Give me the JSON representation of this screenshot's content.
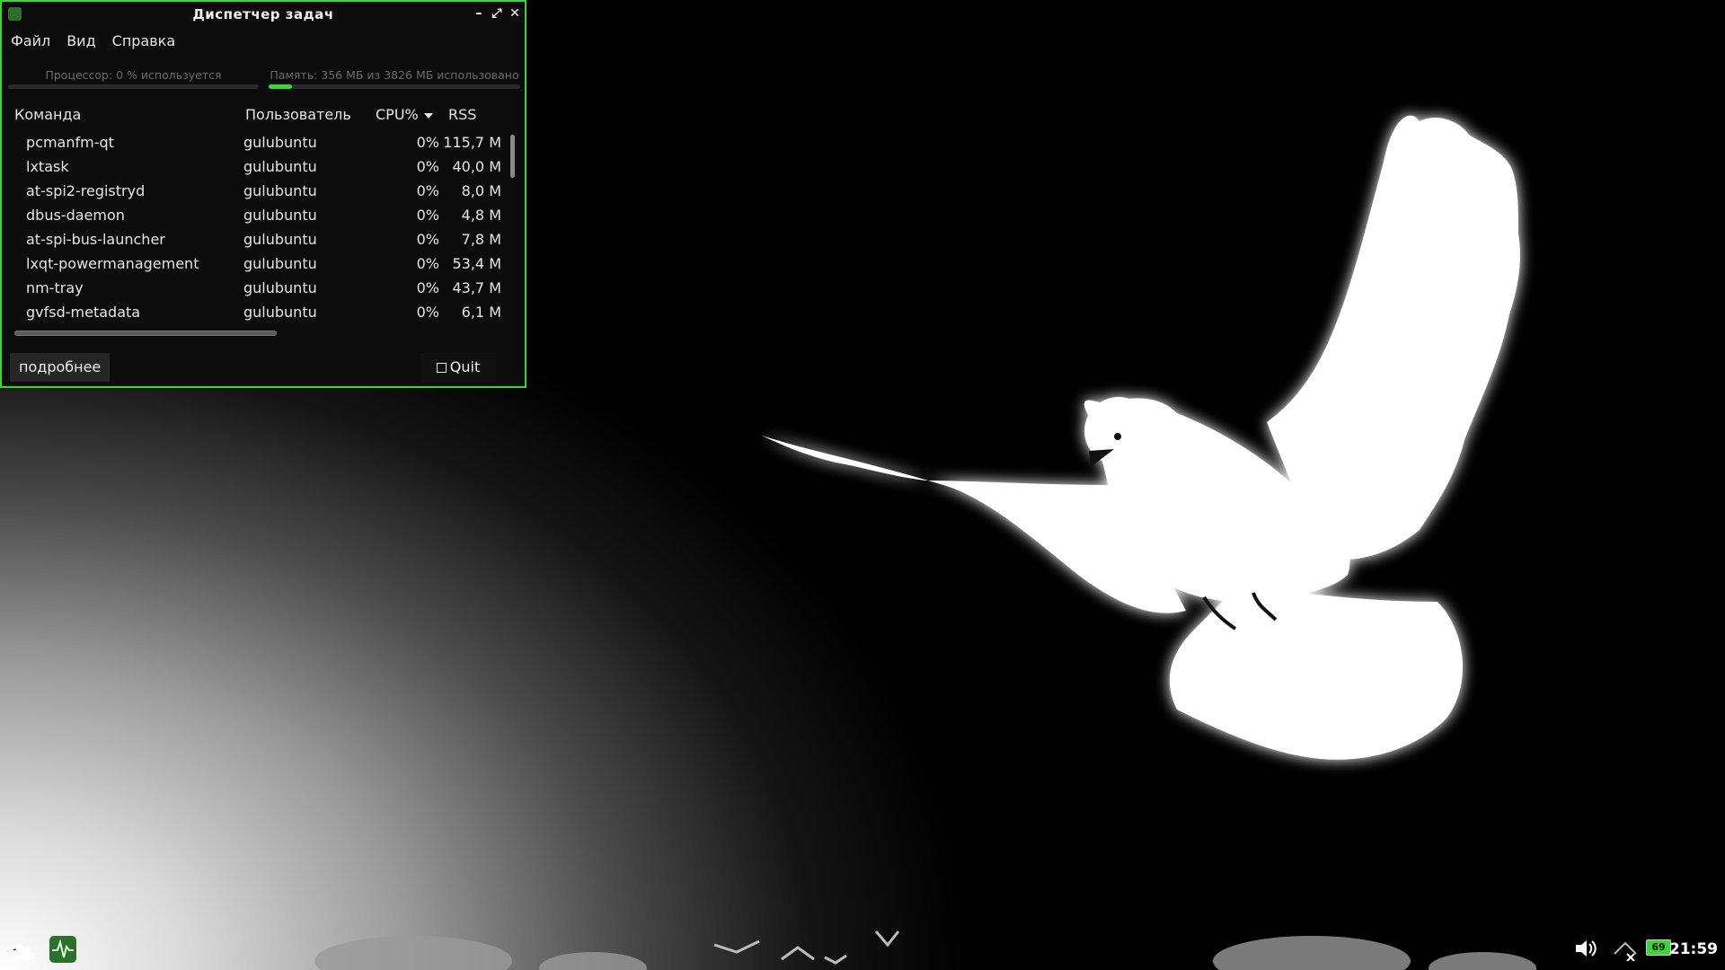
{
  "window": {
    "title": "Диспетчер задач",
    "minimize": "–",
    "maximize": "⤢",
    "close": "✕"
  },
  "menu": [
    "Файл",
    "Вид",
    "Справка"
  ],
  "meters": {
    "cpu_label": "Процессор: 0 % используется",
    "cpu_fraction": 0.0,
    "mem_label": "Память: 356 МБ из 3826 МБ использовано",
    "mem_fraction": 0.093
  },
  "columns": {
    "command": "Команда",
    "user": "Пользователь",
    "cpu": "CPU%",
    "rss": "RSS"
  },
  "processes": [
    {
      "command": "pcmanfm-qt",
      "user": "gulubuntu",
      "cpu": "0%",
      "rss": "115,7 M"
    },
    {
      "command": "lxtask",
      "user": "gulubuntu",
      "cpu": "0%",
      "rss": "40,0 M"
    },
    {
      "command": "at-spi2-registryd",
      "user": "gulubuntu",
      "cpu": "0%",
      "rss": "8,0 M"
    },
    {
      "command": "dbus-daemon",
      "user": "gulubuntu",
      "cpu": "0%",
      "rss": "4,8 M"
    },
    {
      "command": "at-spi-bus-launcher",
      "user": "gulubuntu",
      "cpu": "0%",
      "rss": "7,8 M"
    },
    {
      "command": "lxqt-powermanagement",
      "user": "gulubuntu",
      "cpu": "0%",
      "rss": "53,4 M"
    },
    {
      "command": "nm-tray",
      "user": "gulubuntu",
      "cpu": "0%",
      "rss": "43,7 M"
    },
    {
      "command": "gvfsd-metadata",
      "user": "gulubuntu",
      "cpu": "0%",
      "rss": "6,1 M"
    }
  ],
  "buttons": {
    "details": "подробнее",
    "quit": "Quit"
  },
  "taskbar": {
    "battery_level": "69",
    "clock": "21:59"
  },
  "colors": {
    "accent": "#3dd33a",
    "window_bg": "#0c0c0c"
  }
}
